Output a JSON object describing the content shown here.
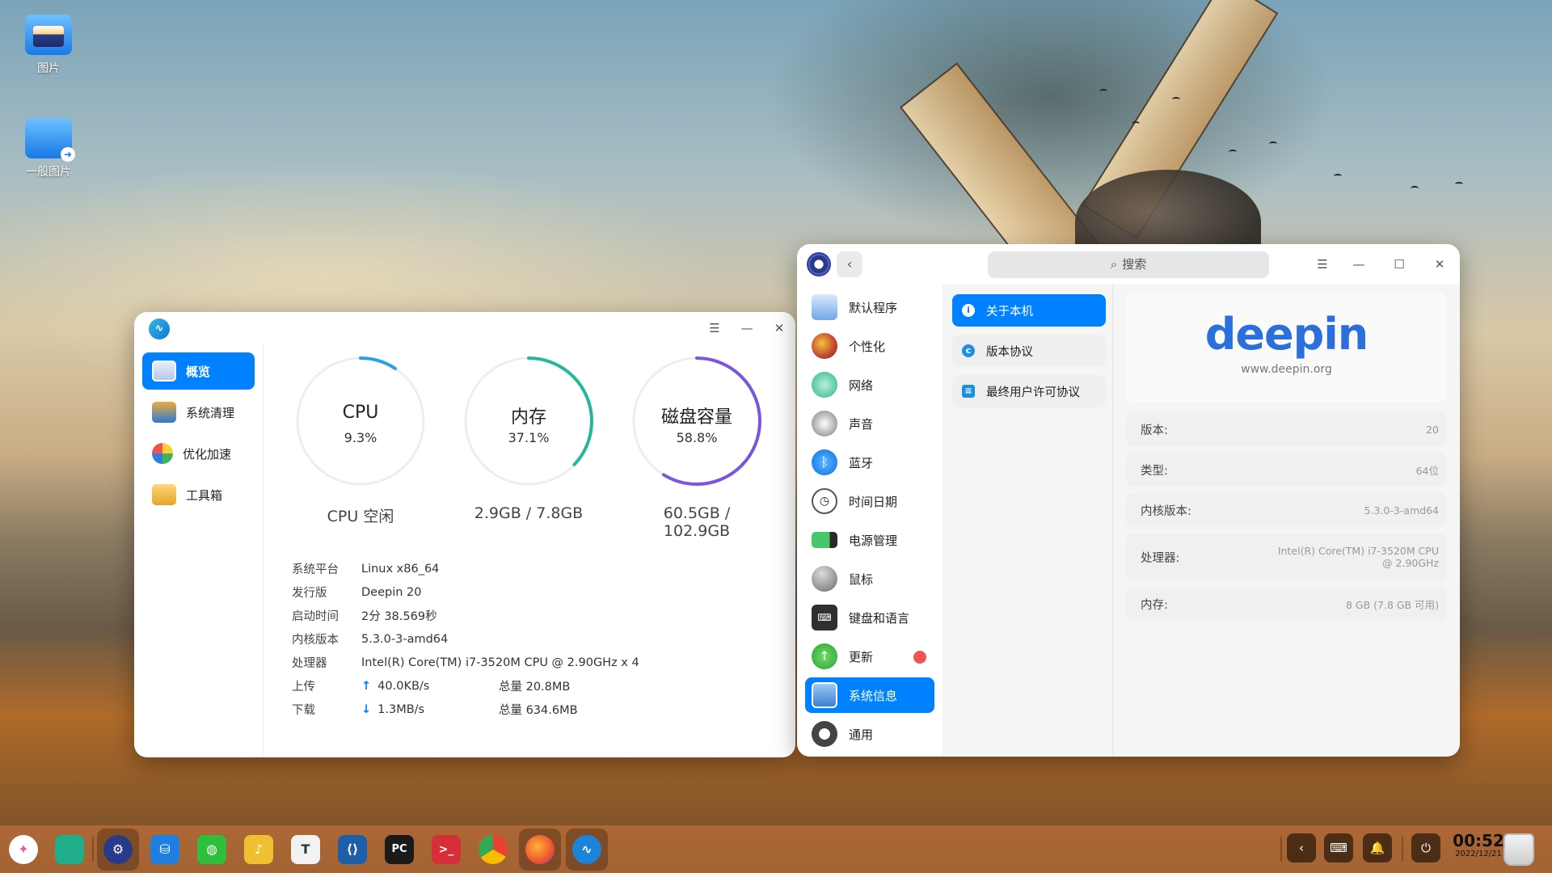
{
  "desktop": {
    "icons": [
      {
        "label": "图片"
      },
      {
        "label": "一般图片"
      }
    ]
  },
  "monitor": {
    "sidebar": [
      {
        "label": "概览"
      },
      {
        "label": "系统清理"
      },
      {
        "label": "优化加速"
      },
      {
        "label": "工具箱"
      }
    ],
    "gauges": [
      {
        "title": "CPU",
        "value": "9.3%",
        "sub": "CPU 空闲",
        "percent": 9.3,
        "color": "#2aa0e8"
      },
      {
        "title": "内存",
        "value": "37.1%",
        "sub": "2.9GB / 7.8GB",
        "percent": 37.1,
        "color": "#22b89a"
      },
      {
        "title": "磁盘容量",
        "value": "58.8%",
        "sub": "60.5GB / 102.9GB",
        "percent": 58.8,
        "color": "#7a56e0"
      }
    ],
    "info": {
      "platform_k": "系统平台",
      "platform_v": "Linux x86_64",
      "release_k": "发行版",
      "release_v": "Deepin 20",
      "uptime_k": "启动时间",
      "uptime_v": "2分 38.569秒",
      "kernel_k": "内核版本",
      "kernel_v": "5.3.0-3-amd64",
      "cpu_k": "处理器",
      "cpu_v": "Intel(R) Core(TM) i7-3520M CPU @ 2.90GHz x 4",
      "upload_k": "上传",
      "upload_speed": "40.0KB/s",
      "upload_total": "总量 20.8MB",
      "download_k": "下载",
      "download_speed": "1.3MB/s",
      "download_total": "总量 634.6MB"
    }
  },
  "control_center": {
    "search_placeholder": "搜索",
    "nav": [
      {
        "label": "默认程序"
      },
      {
        "label": "个性化"
      },
      {
        "label": "网络"
      },
      {
        "label": "声音"
      },
      {
        "label": "蓝牙"
      },
      {
        "label": "时间日期"
      },
      {
        "label": "电源管理"
      },
      {
        "label": "鼠标"
      },
      {
        "label": "键盘和语言"
      },
      {
        "label": "更新"
      },
      {
        "label": "系统信息"
      },
      {
        "label": "通用"
      }
    ],
    "sub_nav": [
      {
        "label": "关于本机"
      },
      {
        "label": "版本协议"
      },
      {
        "label": "最终用户许可协议"
      }
    ],
    "brand": {
      "logo_text": "deepin",
      "url": "www.deepin.org"
    },
    "details": [
      {
        "key": "版本:",
        "value": "20"
      },
      {
        "key": "类型:",
        "value": "64位"
      },
      {
        "key": "内核版本:",
        "value": "5.3.0-3-amd64"
      },
      {
        "key": "处理器:",
        "value": "Intel(R) Core(TM) i7-3520M CPU @ 2.90GHz"
      },
      {
        "key": "内存:",
        "value": "8 GB (7.8 GB 可用)"
      }
    ]
  },
  "dock": {
    "apps": [
      {
        "icon": "launcher-icon",
        "glyph": "✦",
        "color": "#e85a9a"
      },
      {
        "icon": "desktop-icon",
        "glyph": "",
        "color": "#1fae8a"
      },
      {
        "icon": "control-center-icon",
        "glyph": "⚙",
        "color": "#2a3a8a"
      },
      {
        "icon": "app-store-icon",
        "glyph": "⛁",
        "color": "#1f7fe0"
      },
      {
        "icon": "wechat-icon",
        "glyph": "◍",
        "color": "#2fbf3a"
      },
      {
        "icon": "music-icon",
        "glyph": "♪",
        "color": "#f0c030"
      },
      {
        "icon": "text-editor-icon",
        "glyph": "T",
        "color": "#f2f2f2"
      },
      {
        "icon": "vscode-icon",
        "glyph": "⟨⟩",
        "color": "#1d5fa8"
      },
      {
        "icon": "pycharm-icon",
        "glyph": "PC",
        "color": "#1a1a1a"
      },
      {
        "icon": "terminal-icon",
        "glyph": ">_",
        "color": "#d62f3a"
      },
      {
        "icon": "chrome-icon",
        "glyph": "◉",
        "color": "#2fa84f"
      },
      {
        "icon": "firefox-icon",
        "glyph": "◐",
        "color": "#f57a1f"
      },
      {
        "icon": "system-monitor-icon",
        "glyph": "∿",
        "color": "#1b84d8"
      }
    ],
    "clock_time": "00:52",
    "clock_date": "2022/12/21"
  }
}
